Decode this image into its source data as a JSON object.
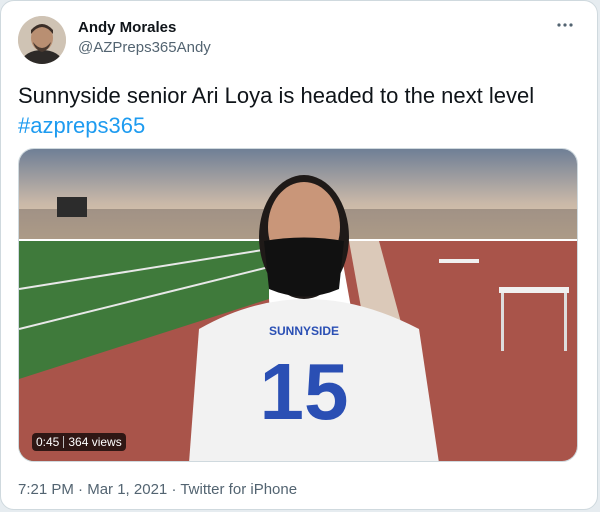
{
  "author": {
    "name": "Andy Morales",
    "handle": "@AZPreps365Andy"
  },
  "tweet": {
    "text": "Sunnyside senior Ari Loya is headed to the next level",
    "hashtag": "#azpreps365"
  },
  "video": {
    "duration": "0:45",
    "views": "364 views",
    "jersey_text": "SUNNYSIDE",
    "jersey_number": "15"
  },
  "meta": {
    "time": "7:21 PM",
    "dot1": "·",
    "date": "Mar 1, 2021",
    "dot2": "·",
    "source": "Twitter for iPhone"
  },
  "colors": {
    "link": "#1d9bf0",
    "secondary_text": "#536471",
    "track_red": "#a9544a",
    "field_green": "#3f7a3b",
    "jersey_blue": "#2a4fb4"
  },
  "icons": {
    "more": "more-horizontal-icon"
  }
}
